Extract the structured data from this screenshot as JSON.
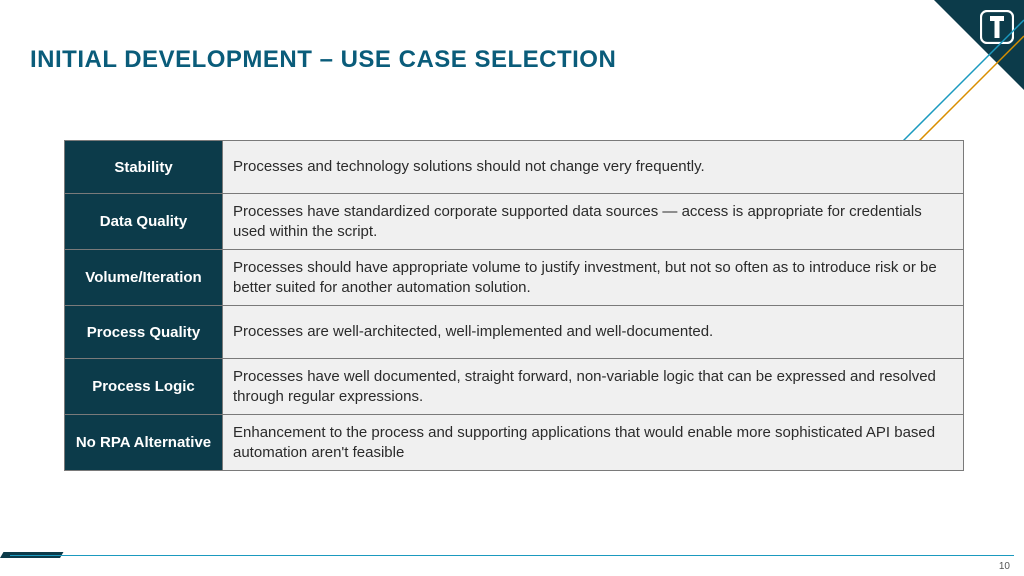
{
  "title": "INITIAL DEVELOPMENT – USE CASE SELECTION",
  "rows": [
    {
      "label": "Stability",
      "desc": "Processes and technology solutions should not change very frequently."
    },
    {
      "label": "Data Quality",
      "desc": "Processes have standardized corporate supported data sources — access is appropriate for credentials used within the script."
    },
    {
      "label": "Volume/Iteration",
      "desc": "Processes should have appropriate volume to justify investment, but not so often as to introduce risk or be better suited for another automation solution."
    },
    {
      "label": "Process Quality",
      "desc": "Processes are well-architected, well-implemented and well-documented."
    },
    {
      "label": "Process Logic",
      "desc": "Processes have well documented, straight forward, non-variable logic that can be expressed and resolved through regular expressions."
    },
    {
      "label": "No RPA Alternative",
      "desc": "Enhancement to the process and supporting applications that would enable more sophisticated API based automation aren't feasible"
    }
  ],
  "page_number": "10"
}
